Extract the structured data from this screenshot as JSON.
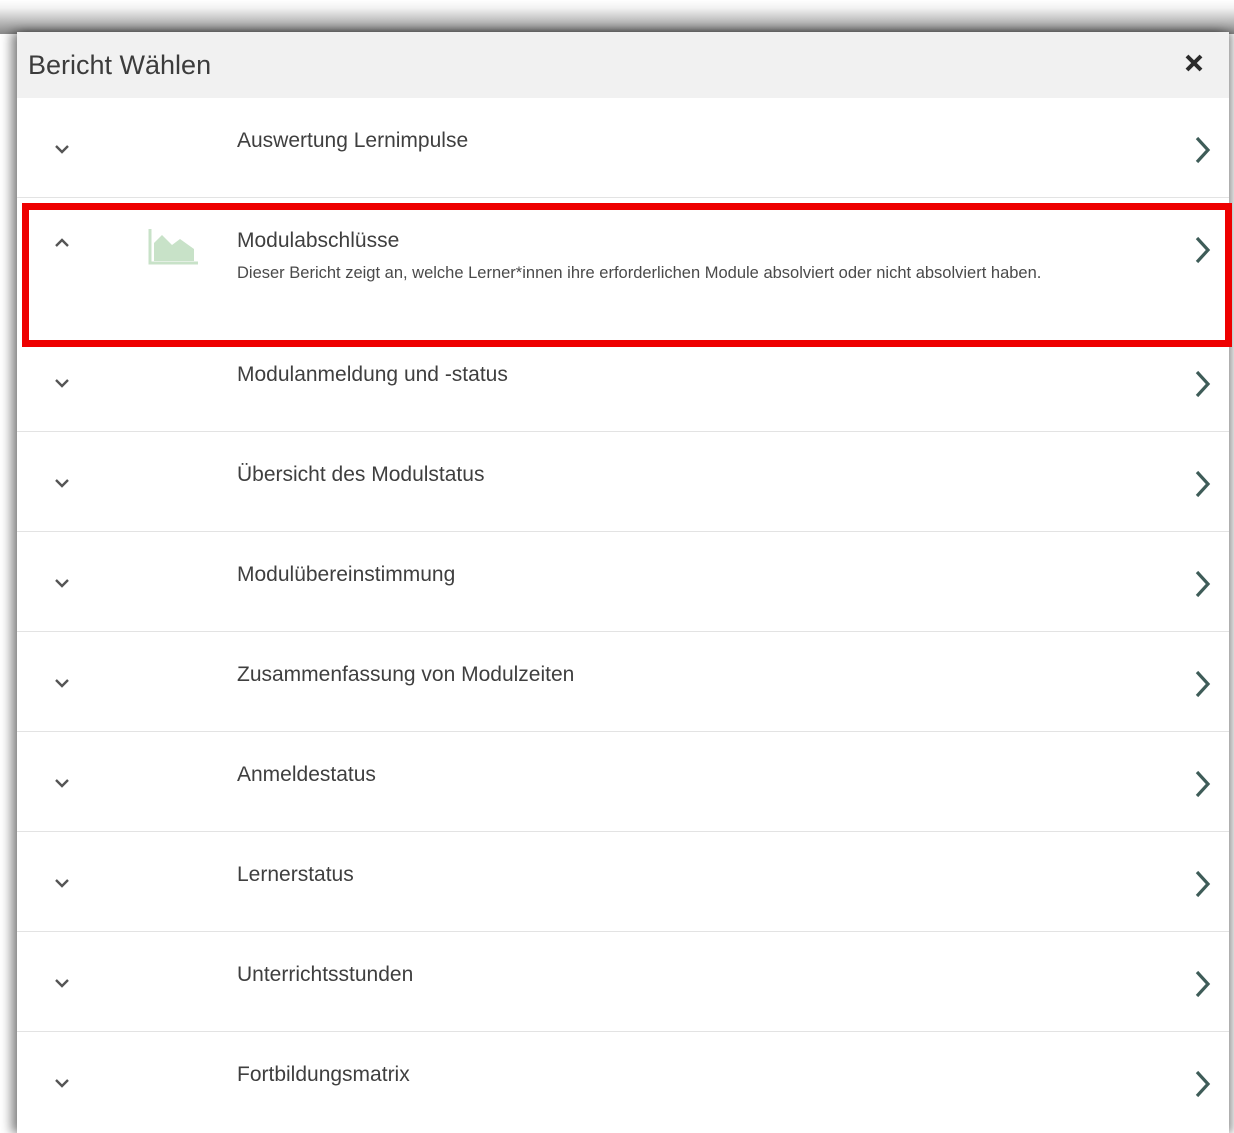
{
  "dialog": {
    "title": "Bericht Wählen",
    "close_icon": "close-icon"
  },
  "colors": {
    "highlight": "#ee0000",
    "chart_icon": "#c8e2c8",
    "chevron": "#555555",
    "arrow": "#3e5c58"
  },
  "reports": [
    {
      "label": "Auswertung Lernimpulse",
      "expanded": false
    },
    {
      "label": "Modulabschlüsse",
      "expanded": true,
      "description": "Dieser Bericht zeigt an, welche Lerner*innen ihre erforderlichen Module absolviert oder nicht absolviert haben.",
      "icon": "area-chart-icon"
    },
    {
      "label": "Modulanmeldung und -status",
      "expanded": false
    },
    {
      "label": "Übersicht des Modulstatus",
      "expanded": false
    },
    {
      "label": "Modulübereinstimmung",
      "expanded": false
    },
    {
      "label": "Zusammenfassung von Modulzeiten",
      "expanded": false
    },
    {
      "label": "Anmeldestatus",
      "expanded": false
    },
    {
      "label": "Lernerstatus",
      "expanded": false
    },
    {
      "label": "Unterrichtsstunden",
      "expanded": false
    },
    {
      "label": "Fortbildungsmatrix",
      "expanded": false
    }
  ]
}
